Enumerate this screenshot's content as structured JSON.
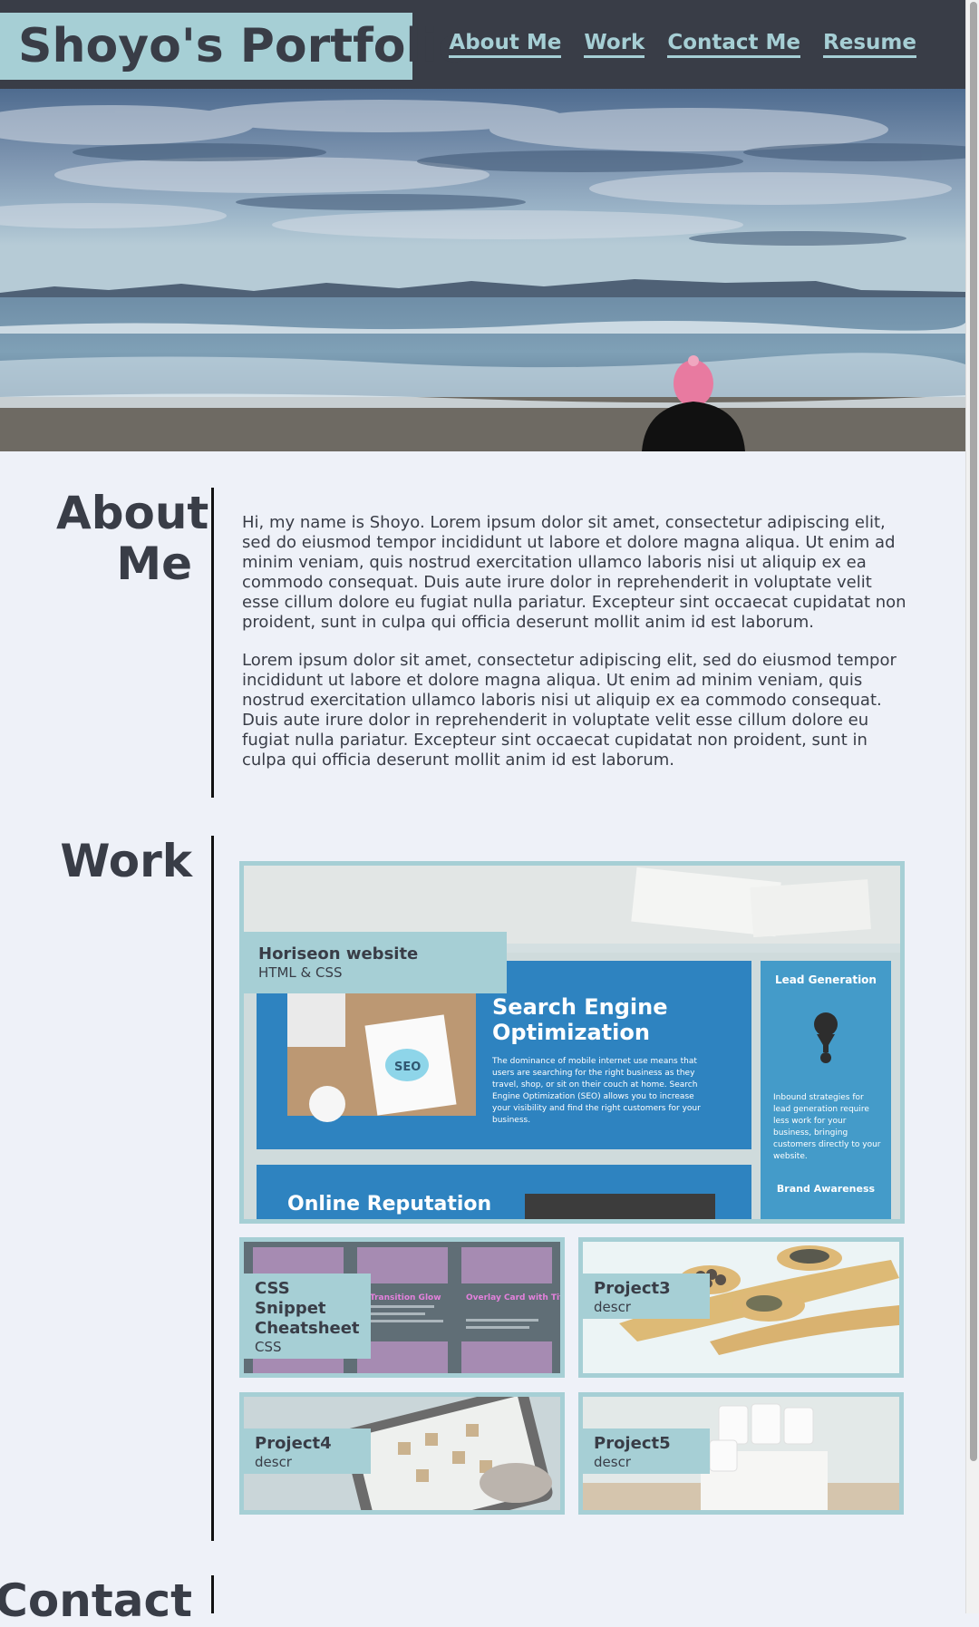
{
  "header": {
    "brand": "Shoyo's Portfolio",
    "nav": [
      "About Me",
      "Work",
      "Contact Me",
      "Resume"
    ]
  },
  "hero": {
    "icon": "beach-landscape-image"
  },
  "about": {
    "title": "About Me",
    "paragraphs": [
      "Hi, my name is Shoyo. Lorem ipsum dolor sit amet, consectetur adipiscing elit, sed do eiusmod tempor incididunt ut labore et dolore magna aliqua. Ut enim ad minim veniam, quis nostrud exercitation ullamco laboris nisi ut aliquip ex ea commodo consequat. Duis aute irure dolor in reprehenderit in voluptate velit esse cillum dolore eu fugiat nulla pariatur. Excepteur sint occaecat cupidatat non proident, sunt in culpa qui officia deserunt mollit anim id est laborum.",
      "Lorem ipsum dolor sit amet, consectetur adipiscing elit, sed do eiusmod tempor incididunt ut labore et dolore magna aliqua. Ut enim ad minim veniam, quis nostrud exercitation ullamco laboris nisi ut aliquip ex ea commodo consequat. Duis aute irure dolor in reprehenderit in voluptate velit esse cillum dolore eu fugiat nulla pariatur. Excepteur sint occaecat cupidatat non proident, sunt in culpa qui officia deserunt mollit anim id est laborum."
    ]
  },
  "work": {
    "title": "Work",
    "featured": {
      "title": "Horiseon website",
      "sub": "HTML & CSS",
      "thumb": {
        "seo_heading": "Search Engine Optimization",
        "seo_body": "The dominance of mobile internet use means that users are searching for the right business as they travel, shop, or sit on their couch at home. Search Engine Optimization (SEO) allows you to increase your visibility and find the right customers for your business.",
        "lead_heading": "Lead Generation",
        "lead_body": "Inbound strategies for lead generation require less work for your business, bringing customers directly to your website.",
        "brand_heading": "Brand Awareness",
        "reputation_heading": "Online Reputation",
        "seo_badge": "SEO"
      }
    },
    "projects": [
      {
        "title": "CSS Snippet Cheatsheet",
        "sub": "CSS",
        "thumb_text_1": "x Transition Glow",
        "thumb_text_2": "Overlay Card with Title"
      },
      {
        "title": "Project3",
        "sub": "descr"
      },
      {
        "title": "Project4",
        "sub": "descr"
      },
      {
        "title": "Project5",
        "sub": "descr"
      }
    ]
  },
  "contact": {
    "title": "Contact"
  },
  "colors": {
    "header_bg": "#393d47",
    "accent": "#a6cfd5",
    "page_bg": "#eef1f8",
    "text": "#393d47"
  }
}
